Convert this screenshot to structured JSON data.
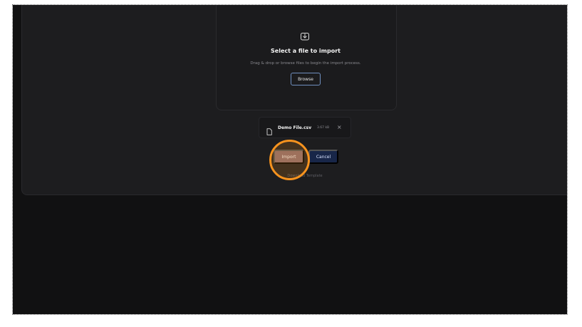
{
  "dropzone": {
    "title": "Select a file to import",
    "subtitle": "Drag & drop or browse files to begin the import process.",
    "browse_label": "Browse",
    "icon": "download-icon"
  },
  "file": {
    "name": "Demo File.csv",
    "size": "3.67 kB",
    "remove_icon": "×"
  },
  "actions": {
    "import_label": "Import",
    "cancel_label": "Cancel",
    "download_label": "Download Template"
  },
  "colors": {
    "background": "#111112",
    "panel": "#1d1d1f",
    "import_button": "#8a6a6b",
    "cancel_button": "#182648",
    "click_indicator": "#f7931e"
  }
}
